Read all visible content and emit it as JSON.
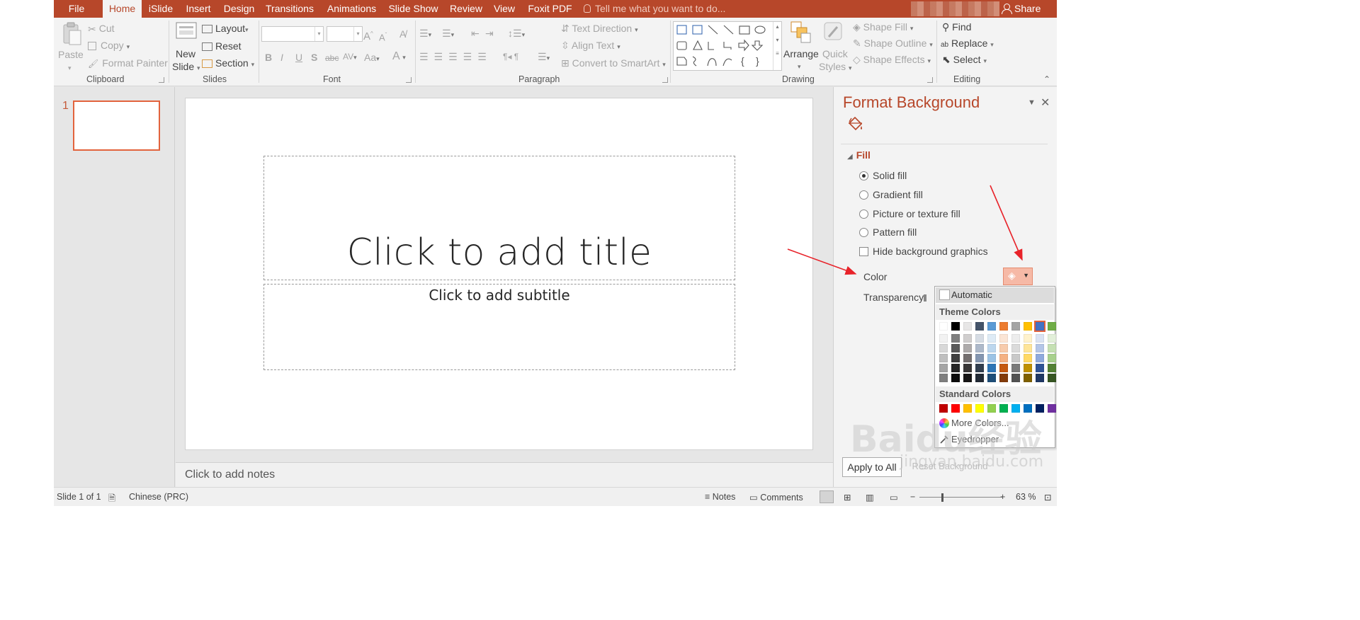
{
  "tabs": [
    {
      "label": "File",
      "active": false
    },
    {
      "label": "Home",
      "active": true
    },
    {
      "label": "iSlide",
      "active": false
    },
    {
      "label": "Insert",
      "active": false
    },
    {
      "label": "Design",
      "active": false
    },
    {
      "label": "Transitions",
      "active": false
    },
    {
      "label": "Animations",
      "active": false
    },
    {
      "label": "Slide Show",
      "active": false
    },
    {
      "label": "Review",
      "active": false
    },
    {
      "label": "View",
      "active": false
    },
    {
      "label": "Foxit PDF",
      "active": false
    }
  ],
  "tell_me": "Tell me what you want to do...",
  "share": "Share",
  "ribbon": {
    "clipboard": {
      "paste": "Paste",
      "cut": "Cut",
      "copy": "Copy",
      "format_painter": "Format Painter",
      "group": "Clipboard"
    },
    "slides": {
      "new_slide_1": "New",
      "new_slide_2": "Slide",
      "layout": "Layout",
      "reset": "Reset",
      "section": "Section",
      "group": "Slides"
    },
    "font": {
      "group": "Font"
    },
    "paragraph": {
      "text_direction": "Text Direction",
      "align_text": "Align Text",
      "convert_smartart": "Convert to SmartArt",
      "group": "Paragraph"
    },
    "drawing": {
      "arrange": "Arrange",
      "quick_1": "Quick",
      "quick_2": "Styles",
      "shape_fill": "Shape Fill",
      "shape_outline": "Shape Outline",
      "shape_effects": "Shape Effects",
      "group": "Drawing"
    },
    "editing": {
      "find": "Find",
      "replace": "Replace",
      "select": "Select",
      "group": "Editing"
    }
  },
  "thumbnail": {
    "number": "1"
  },
  "slide": {
    "title_placeholder": "Click to add title",
    "subtitle_placeholder": "Click to add subtitle"
  },
  "notes": "Click to add notes",
  "format_background": {
    "title": "Format Background",
    "section": "Fill",
    "options": [
      {
        "label": "Solid fill",
        "type": "radio",
        "checked": true
      },
      {
        "label": "Gradient fill",
        "type": "radio",
        "checked": false
      },
      {
        "label": "Picture or texture fill",
        "type": "radio",
        "checked": false
      },
      {
        "label": "Pattern fill",
        "type": "radio",
        "checked": false
      },
      {
        "label": "Hide background graphics",
        "type": "checkbox",
        "checked": false
      }
    ],
    "color_label": "Color",
    "transparency_label": "Transparency",
    "apply_all": "Apply to All",
    "reset_background": "Reset Background"
  },
  "color_popup": {
    "automatic": "Automatic",
    "theme_colors_label": "Theme Colors",
    "theme_top": [
      "#FFFFFF",
      "#000000",
      "#E7E6E6",
      "#44546A",
      "#5B9BD5",
      "#ED7D31",
      "#A5A5A5",
      "#FFC000",
      "#4472C4",
      "#70AD47"
    ],
    "theme_shades": [
      [
        "#F2F2F2",
        "#7F7F7F",
        "#D0CECE",
        "#D6DCE4",
        "#DEEBF6",
        "#FBE5D5",
        "#EDEDED",
        "#FFF2CC",
        "#DAE3F3",
        "#E2EFD9"
      ],
      [
        "#D8D8D8",
        "#595959",
        "#AEABAB",
        "#ADB9CA",
        "#BDD7EE",
        "#F7CBAC",
        "#DBDBDB",
        "#FEE599",
        "#B4C6E7",
        "#C5E0B3"
      ],
      [
        "#BFBFBF",
        "#3F3F3F",
        "#757070",
        "#8496B0",
        "#9CC3E5",
        "#F4B183",
        "#C9C9C9",
        "#FFD965",
        "#8FAADC",
        "#A8D08D"
      ],
      [
        "#A5A5A5",
        "#262626",
        "#3A3838",
        "#323F4F",
        "#2E75B5",
        "#C55A11",
        "#7B7B7B",
        "#BF9000",
        "#2F5496",
        "#538135"
      ],
      [
        "#7F7F7F",
        "#0C0C0C",
        "#171616",
        "#222A35",
        "#1E4E79",
        "#833C0B",
        "#525252",
        "#7F6000",
        "#1F3864",
        "#375623"
      ]
    ],
    "standard_colors_label": "Standard Colors",
    "standard": [
      "#C00000",
      "#FF0000",
      "#FFC000",
      "#FFFF00",
      "#92D050",
      "#00B050",
      "#00B0F0",
      "#0070C0",
      "#002060",
      "#7030A0"
    ],
    "more_colors": "More Colors...",
    "eyedropper": "Eyedropper"
  },
  "status": {
    "slide_count": "Slide 1 of 1",
    "language": "Chinese (PRC)",
    "notes": "Notes",
    "comments": "Comments",
    "zoom": "63 %"
  },
  "watermark": {
    "line1": "Baidu经验",
    "line2": "jingyan.baidu.com"
  },
  "colors": {
    "accent": "#B7472A",
    "thumb_border": "#E2633D",
    "annotation_arrow": "#E8232A"
  }
}
